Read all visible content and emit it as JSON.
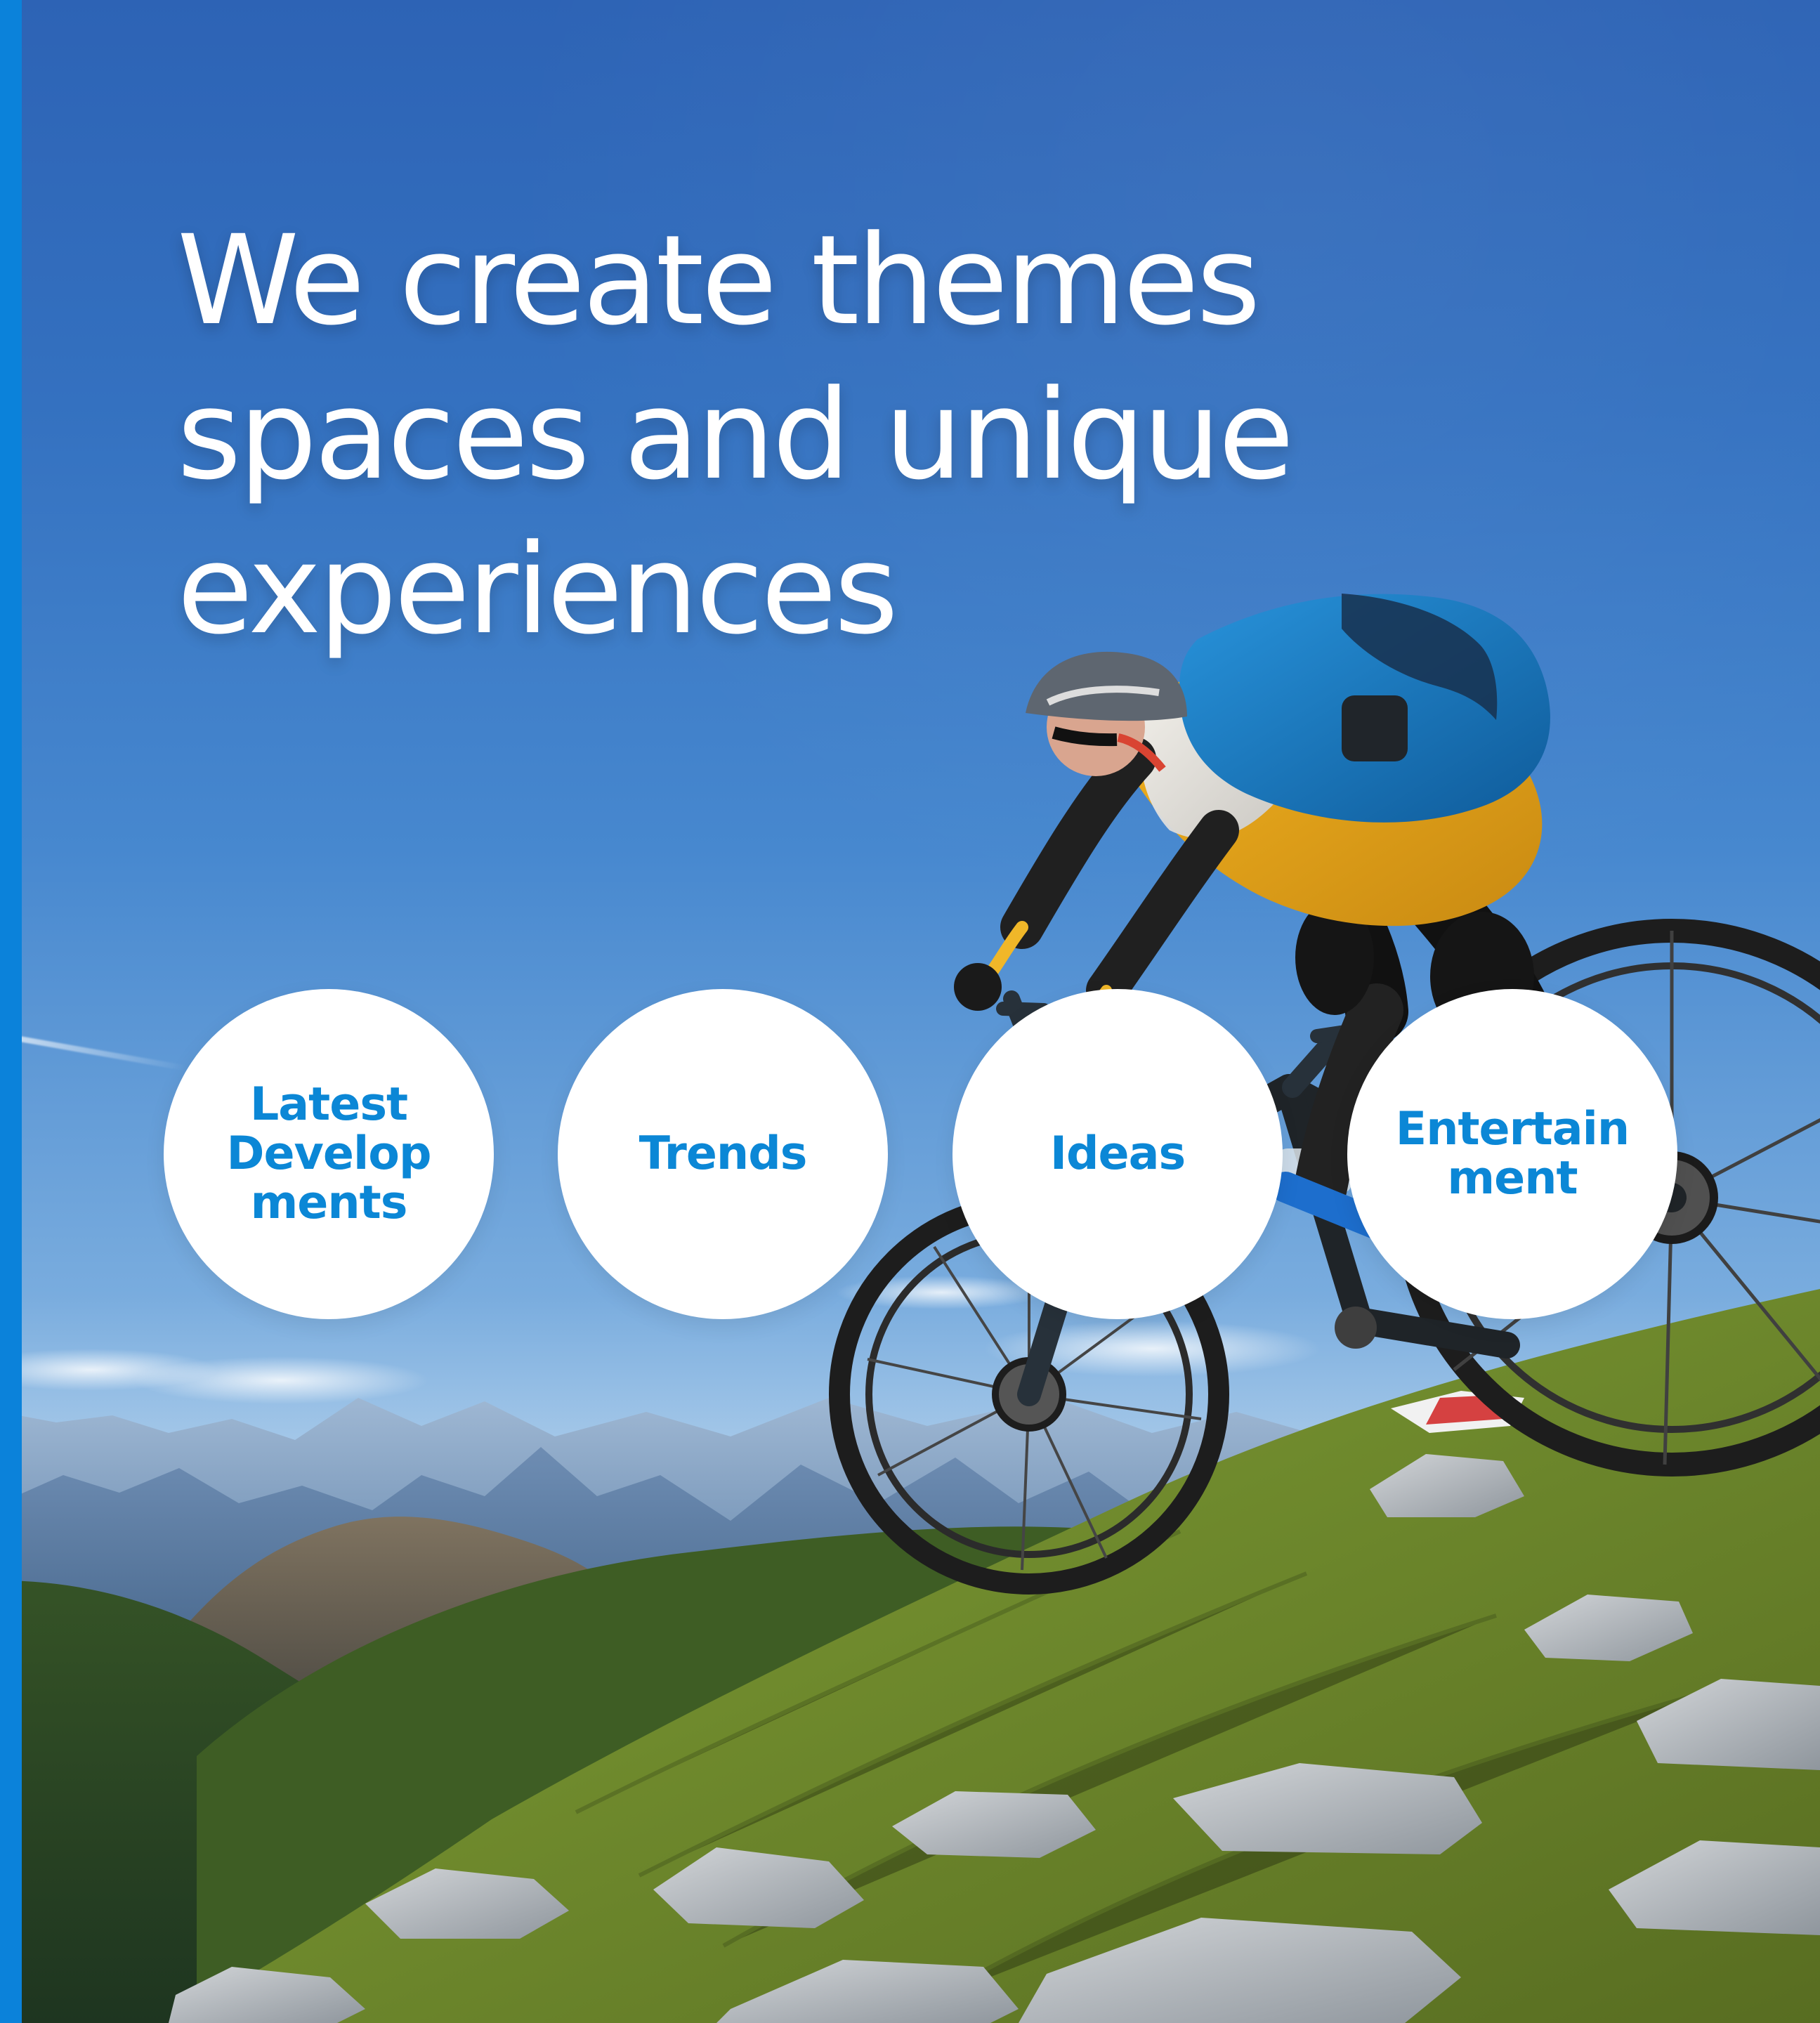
{
  "hero": {
    "headline_lines": [
      "We create themes",
      "spaces and unique",
      "experiences"
    ]
  },
  "topics": [
    {
      "label": "Latest\nDevelop\nments"
    },
    {
      "label": "Trends"
    },
    {
      "label": "Ideas"
    },
    {
      "label": "Entertain\nment"
    }
  ],
  "colors": {
    "accent_bar": "#0B82DA",
    "topic_text": "#0B87D6",
    "circle_fill": "#FFFFFF",
    "headline_text": "#FFFFFF"
  }
}
